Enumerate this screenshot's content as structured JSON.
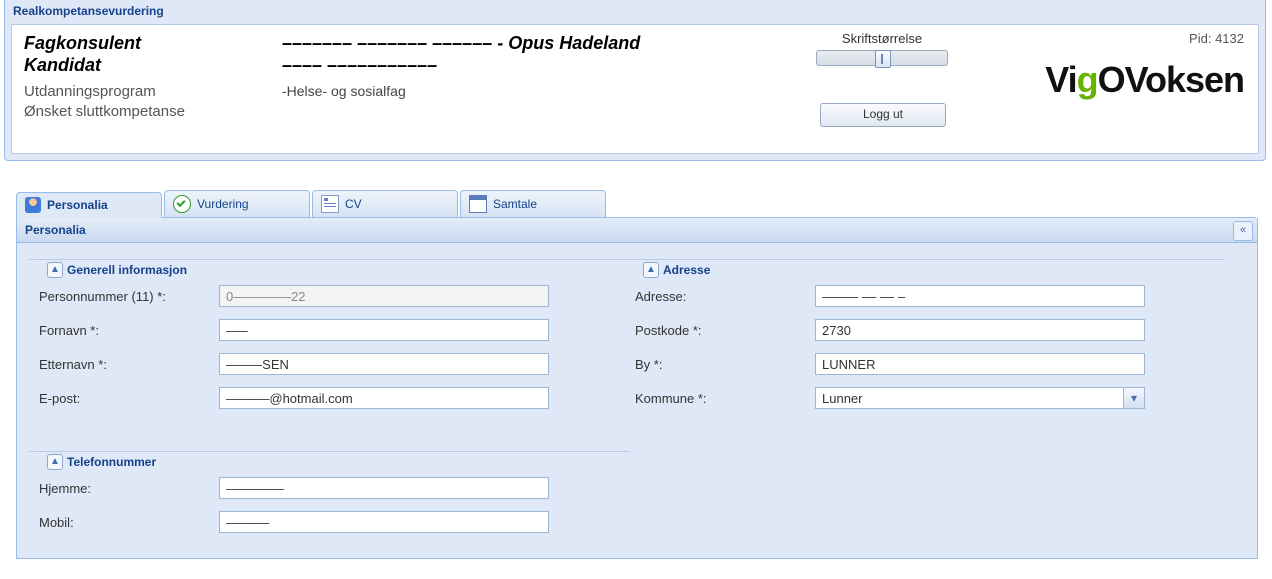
{
  "top": {
    "title": "Realkompetansevurdering",
    "labels": {
      "fagkonsulent": "Fagkonsulent",
      "kandidat": "Kandidat",
      "utdanningsprogram": "Utdanningsprogram",
      "onsket_sluttkompetanse": "Ønsket sluttkompetanse"
    },
    "values": {
      "fagkonsulent": "––––––– –––––––  –––––– - Opus Hadeland",
      "kandidat": "–––– –––––––––––",
      "utdanningsprogram": "-Helse- og sosialfag",
      "onsket_sluttkompetanse": ""
    },
    "font_size_label": "Skriftstørrelse",
    "logout_label": "Logg ut",
    "pid_label": "Pid:",
    "pid_value": "4132",
    "logo_pre": "Vi",
    "logo_g": "g",
    "logo_post": "OVoksen"
  },
  "tabs": [
    {
      "id": "personalia",
      "label": "Personalia",
      "icon": "user-icon",
      "active": true
    },
    {
      "id": "vurdering",
      "label": "Vurdering",
      "icon": "check-icon",
      "active": false
    },
    {
      "id": "cv",
      "label": "CV",
      "icon": "form-icon",
      "active": false
    },
    {
      "id": "samtale",
      "label": "Samtale",
      "icon": "window-icon",
      "active": false
    }
  ],
  "panel": {
    "title": "Personalia",
    "fieldsets": {
      "general": {
        "legend": "Generell informasjon",
        "fields": {
          "personnummer": {
            "label": "Personnummer (11) *:",
            "value": "0––––––––22",
            "disabled": true
          },
          "fornavn": {
            "label": "Fornavn *:",
            "value": "–––"
          },
          "etternavn": {
            "label": "Etternavn *:",
            "value": "–––––SEN"
          },
          "epost": {
            "label": "E-post:",
            "value": "––––––@hotmail.com"
          }
        }
      },
      "address": {
        "legend": "Adresse",
        "fields": {
          "adresse": {
            "label": "Adresse:",
            "value": "––––– –– –– –"
          },
          "postkode": {
            "label": "Postkode *:",
            "value": "2730"
          },
          "by": {
            "label": "By *:",
            "value": "LUNNER"
          },
          "kommune": {
            "label": "Kommune *:",
            "value": "Lunner",
            "type": "select"
          }
        }
      },
      "phone": {
        "legend": "Telefonnummer",
        "fields": {
          "hjemme": {
            "label": "Hjemme:",
            "value": "––––––––"
          },
          "mobil": {
            "label": "Mobil:",
            "value": "––––––"
          }
        }
      }
    }
  }
}
